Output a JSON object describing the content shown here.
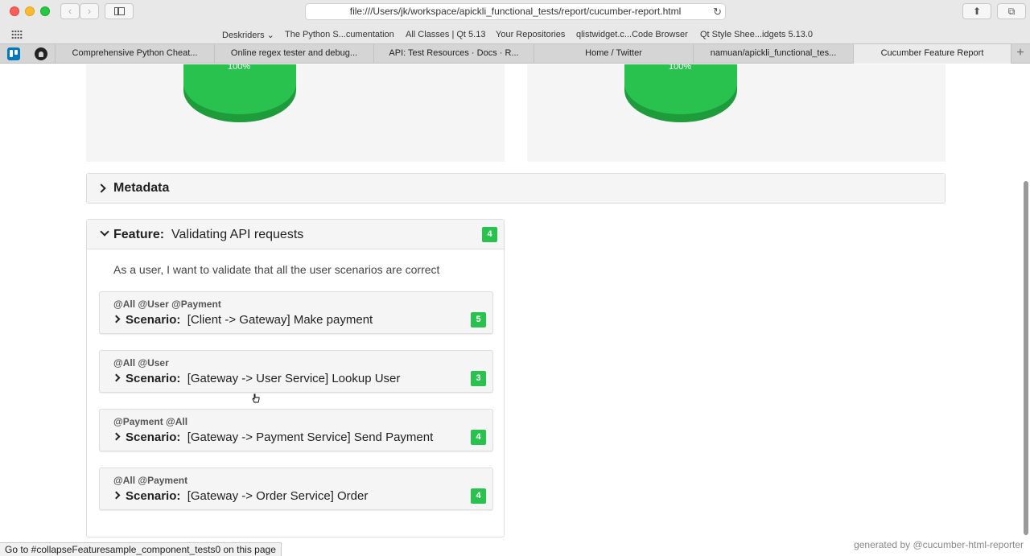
{
  "browser": {
    "url": "file:///Users/jk/workspace/apickli_functional_tests/report/cucumber-report.html",
    "bookmarks": [
      "Deskriders",
      "The Python S...cumentation",
      "All Classes | Qt 5.13",
      "Your Repositories",
      "qlistwidget.c...Code Browser",
      "Qt Style Shee...idgets 5.13.0"
    ],
    "tabs": [
      "Comprehensive Python Cheat...",
      "Online regex tester and debug...",
      "API: Test Resources · Docs · R...",
      "Home / Twitter",
      "namuan/apickli_functional_tes...",
      "Cucumber Feature Report"
    ],
    "status_text": "Go to #collapseFeaturesample_component_tests0 on this page"
  },
  "charts": {
    "left_pct": "100%",
    "right_pct": "100%",
    "colors": {
      "passed": "#2ac24f",
      "passed_shadow": "#1e9b3a"
    }
  },
  "metadata": {
    "label": "Metadata"
  },
  "feature": {
    "keyword": "Feature:",
    "name": "Validating API requests",
    "count": "4",
    "description": "As a user, I want to validate that all the user scenarios are correct",
    "scenarios": [
      {
        "tags": "@All @User @Payment",
        "keyword": "Scenario:",
        "name": "[Client -> Gateway] Make payment",
        "count": "5"
      },
      {
        "tags": "@All @User",
        "keyword": "Scenario:",
        "name": "[Gateway -> User Service] Lookup User",
        "count": "3"
      },
      {
        "tags": "@Payment @All",
        "keyword": "Scenario:",
        "name": "[Gateway -> Payment Service] Send Payment",
        "count": "4"
      },
      {
        "tags": "@All @Payment",
        "keyword": "Scenario:",
        "name": "[Gateway -> Order Service] Order",
        "count": "4"
      }
    ]
  },
  "footer": "generated by @cucumber-html-reporter"
}
